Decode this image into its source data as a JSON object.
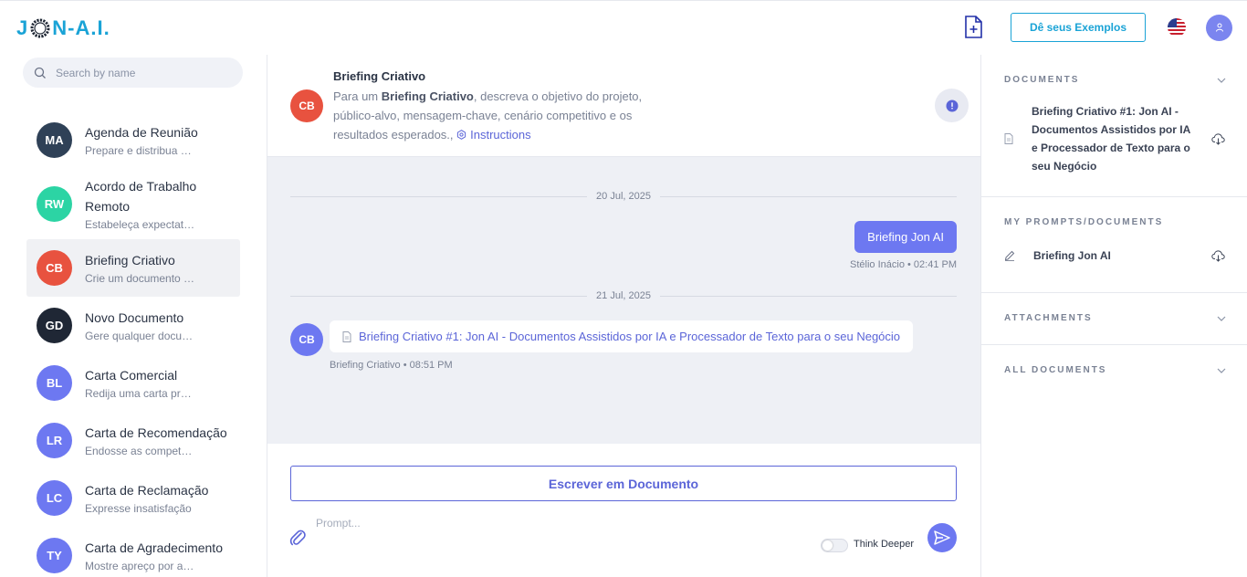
{
  "header": {
    "logo_text_left": "J",
    "logo_text_right": "N-A.I.",
    "examples_button": "Dê seus Exemplos"
  },
  "sidebar": {
    "search_placeholder": "Search by name",
    "contacts": [
      {
        "initials": "MA",
        "name": "Agenda de Reunião",
        "desc": "Prepare e distribua uma agenda",
        "color": "#2f4157"
      },
      {
        "initials": "RW",
        "name": "Acordo de Trabalho Remoto",
        "desc": "Estabeleça expectativas claras",
        "color": "#2cd4a4"
      },
      {
        "initials": "CB",
        "name": "Briefing Criativo",
        "desc": "Crie um documento detalhado",
        "color": "#e8523f"
      },
      {
        "initials": "GD",
        "name": "Novo Documento",
        "desc": "Gere qualquer documento",
        "color": "#1f2735"
      },
      {
        "initials": "BL",
        "name": "Carta Comercial",
        "desc": "Redija uma carta profissional",
        "color": "#6d78f1"
      },
      {
        "initials": "LR",
        "name": "Carta de Recomendação",
        "desc": "Endosse as competências",
        "color": "#6d78f1"
      },
      {
        "initials": "LC",
        "name": "Carta de Reclamação",
        "desc": "Expresse insatisfação",
        "color": "#6d78f1"
      },
      {
        "initials": "TY",
        "name": "Carta de Agradecimento",
        "desc": "Mostre apreço por ajuda",
        "color": "#6d78f1"
      }
    ]
  },
  "chat": {
    "header": {
      "initials": "CB",
      "title": "Briefing Criativo",
      "desc_prefix": "Para um ",
      "desc_bold": "Briefing Criativo",
      "desc_suffix": ", descreva o objetivo do projeto, público-alvo, mensagem-chave, cenário competitivo e os resultados esperados., ",
      "instructions": "Instructions"
    },
    "date1": "20 Jul, 2025",
    "out_message": "Briefing Jon AI",
    "out_meta": "Stélio Inácio • 02:41 PM",
    "date2": "21 Jul, 2025",
    "in_initials": "CB",
    "in_message": "Briefing Criativo #1: Jon AI - Documentos Assistidos por IA e Processador de Texto para o seu Negócio",
    "in_meta": "Briefing Criativo • 08:51 PM",
    "write_button": "Escrever em Documento",
    "prompt_placeholder": "Prompt...",
    "think_deeper": "Think Deeper"
  },
  "right_panel": {
    "documents_title": "DOCUMENTS",
    "document_item": "Briefing Criativo #1: Jon AI - Documentos Assistidos por IA e Processador de Texto para o seu Negócio",
    "my_prompts_title": "MY PROMPTS/DOCUMENTS",
    "prompt_item": "Briefing Jon AI",
    "attachments_title": "ATTACHMENTS",
    "all_documents_title": "ALL DOCUMENTS"
  },
  "colors": {
    "accent": "#6d78f1",
    "brand": "#1aa3d6"
  }
}
